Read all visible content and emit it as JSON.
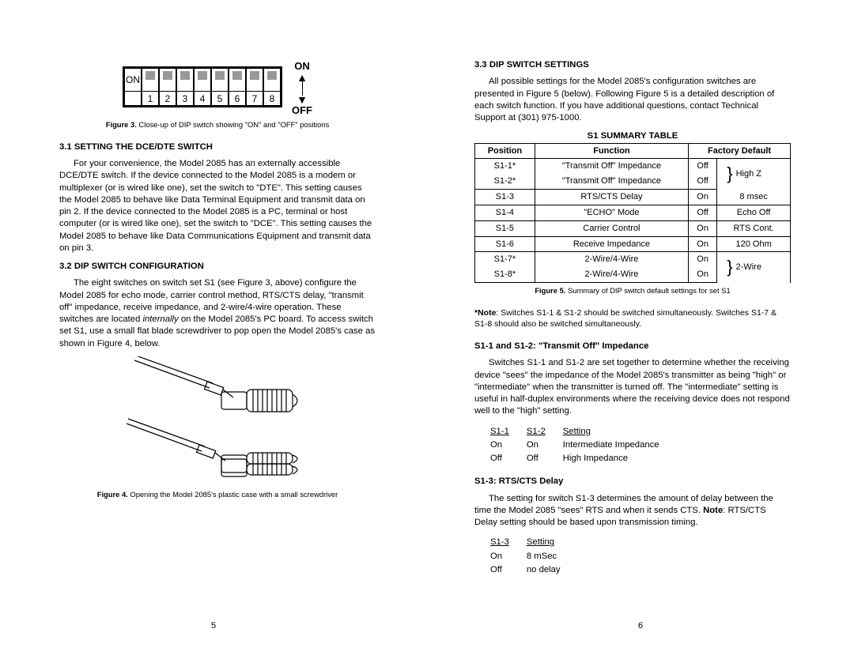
{
  "left": {
    "dip": {
      "on_label": "ON",
      "nums": [
        "1",
        "2",
        "3",
        "4",
        "5",
        "6",
        "7",
        "8"
      ],
      "side_on": "ON",
      "side_off": "OFF"
    },
    "fig3_caption_b": "Figure 3.",
    "fig3_caption": "Close-up of DIP switch showing \"ON\" and \"OFF\" positions",
    "h31": "3.1 SETTING THE DCE/DTE SWITCH",
    "p31": "For your convenience, the Model 2085 has an externally accessible DCE/DTE switch.  If the device connected to the Model 2085 is a modem or multiplexer (or is wired like one), set the switch to \"DTE\".  This setting causes the Model 2085 to behave like Data Terminal Equipment and transmit data on pin 2.  If the device connected to the Model 2085 is a PC, terminal or host computer (or is wired like one), set the switch to \"DCE\".  This setting causes the Model 2085 to behave like Data Communications Equipment and transmit data on pin 3.",
    "h32": "3.2 DIP SWITCH CONFIGURATION",
    "p32a": "The eight switches on switch set S1 (see Figure 3, above) configure the Model 2085 for echo mode, carrier control method, RTS/CTS delay, \"transmit off\" impedance, receive impedance, and 2-wire/4-wire operation. These switches are located ",
    "p32i": "internally",
    "p32b": " on the Model 2085's PC board. To access switch set S1, use a small flat blade screwdriver to pop open the Model 2085's case as shown in Figure 4, below.",
    "fig4_caption_b": "Figure 4.",
    "fig4_caption": "Opening the Model 2085's plastic case with a small screwdriver",
    "pagenum": "5"
  },
  "right": {
    "h33": "3.3 DIP SWITCH SETTINGS",
    "p33": "All possible settings for the Model 2085's configuration switches are presented in Figure 5 (below).  Following Figure 5 is a detailed description of each switch function.  If you have additional questions, contact Technical Support at (301) 975-1000.",
    "table_title": "S1 SUMMARY TABLE",
    "th_pos": "Position",
    "th_func": "Function",
    "th_def": "Factory Default",
    "rows": [
      {
        "p": "S1-1*",
        "f": "\"Transmit Off\" Impedance",
        "d1": "Off",
        "sep": false
      },
      {
        "p": "S1-2*",
        "f": "\"Transmit Off\" Impedance",
        "d1": "Off",
        "sep": true,
        "merge": "High Z"
      },
      {
        "p": "S1-3",
        "f": "RTS/CTS Delay",
        "d1": "On",
        "d2": "8 msec",
        "sep": true
      },
      {
        "p": "S1-4",
        "f": "\"ECHO\" Mode",
        "d1": "Off",
        "d2": "Echo Off",
        "sep": true
      },
      {
        "p": "S1-5",
        "f": "Carrier Control",
        "d1": "On",
        "d2": "RTS Cont.",
        "sep": true
      },
      {
        "p": "S1-6",
        "f": "Receive Impedance",
        "d1": "On",
        "d2": "120 Ohm",
        "sep": true
      },
      {
        "p": "S1-7*",
        "f": "2-Wire/4-Wire",
        "d1": "On",
        "sep": false
      },
      {
        "p": "S1-8*",
        "f": "2-Wire/4-Wire",
        "d1": "On",
        "sep": true,
        "merge": "2-Wire"
      }
    ],
    "fig5_caption_b": "Figure 5.",
    "fig5_caption": "Summary of DIP switch default settings for set S1",
    "note_b": "*Note",
    "note": ": Switches S1-1 & S1-2 should be switched simultaneously. Switches S1-7 & S1-8 should also be switched simultaneously.",
    "h_s12": "S1-1 and S1-2:  \"Transmit Off\" Impedance",
    "p_s12": "Switches S1-1 and S1-2 are set together to determine whether the receiving device \"sees\" the impedance of the Model 2085's transmitter as being \"high\" or \"intermediate\" when the transmitter is turned off.  The \"intermediate\" setting is useful in half-duplex environments where the receiving device does not respond well to the \"high\" setting.",
    "t12": {
      "h": [
        "S1-1",
        "S1-2",
        "Setting"
      ],
      "r": [
        [
          "On",
          "On",
          "Intermediate Impedance"
        ],
        [
          "Off",
          "Off",
          "High Impedance"
        ]
      ]
    },
    "h_s13": "S1-3:  RTS/CTS Delay",
    "p_s13a": "The setting for switch S1-3 determines the amount of delay between the time the Model 2085 \"sees\" RTS and when it sends CTS. ",
    "p_s13_b": "Note",
    "p_s13b": ":  RTS/CTS Delay setting should be based upon transmission timing.",
    "t13": {
      "h": [
        "S1-3",
        "Setting"
      ],
      "r": [
        [
          "On",
          "8 mSec"
        ],
        [
          "Off",
          "no delay"
        ]
      ]
    },
    "pagenum": "6"
  }
}
